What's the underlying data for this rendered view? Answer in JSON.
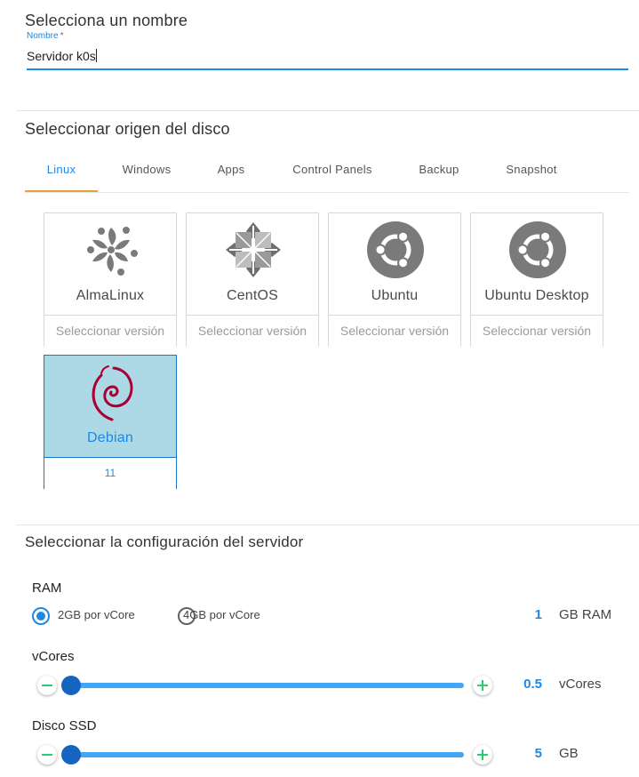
{
  "name_section": {
    "title": "Selecciona un nombre",
    "field_label": "Nombre",
    "required_mark": "*",
    "value": "Servidor k0s"
  },
  "disk_section": {
    "title": "Seleccionar origen del disco",
    "tabs": [
      {
        "label": "Linux",
        "active": true
      },
      {
        "label": "Windows",
        "active": false
      },
      {
        "label": "Apps",
        "active": false
      },
      {
        "label": "Control Panels",
        "active": false
      },
      {
        "label": "Backup",
        "active": false
      },
      {
        "label": "Snapshot",
        "active": false
      }
    ],
    "images": [
      {
        "name": "AlmaLinux",
        "version": "Seleccionar versión",
        "icon": "almalinux-logo-icon",
        "selected": false
      },
      {
        "name": "CentOS",
        "version": "Seleccionar versión",
        "icon": "centos-logo-icon",
        "selected": false
      },
      {
        "name": "Ubuntu",
        "version": "Seleccionar versión",
        "icon": "ubuntu-logo-icon",
        "selected": false
      },
      {
        "name": "Ubuntu Desktop",
        "version": "Seleccionar versión",
        "icon": "ubuntu-logo-icon",
        "selected": false
      },
      {
        "name": "Debian",
        "version": "11",
        "icon": "debian-logo-icon",
        "selected": true
      }
    ]
  },
  "config_section": {
    "title": "Seleccionar la configuración del servidor",
    "ram": {
      "label": "RAM",
      "options": [
        {
          "label": "2GB por vCore",
          "selected": true
        },
        {
          "label": "4GB por vCore",
          "selected": false
        }
      ],
      "value": "1",
      "unit": "GB RAM"
    },
    "vcores": {
      "label": "vCores",
      "value": "0.5",
      "unit": "vCores",
      "slider_fraction": 0.0
    },
    "disk": {
      "label": "Disco SSD",
      "value": "5",
      "unit": "GB",
      "slider_fraction": 0.0
    }
  },
  "colors": {
    "accent": "#1e88e5",
    "tab_indicator": "#e6a532",
    "selected_card_bg": "#add8e6",
    "plus_minus": "#2ecc71",
    "slider_thumb": "#1565c0",
    "slider_track": "#42a5f5",
    "debian_red": "#a80030",
    "logo_gray": "#7a7a7a"
  }
}
